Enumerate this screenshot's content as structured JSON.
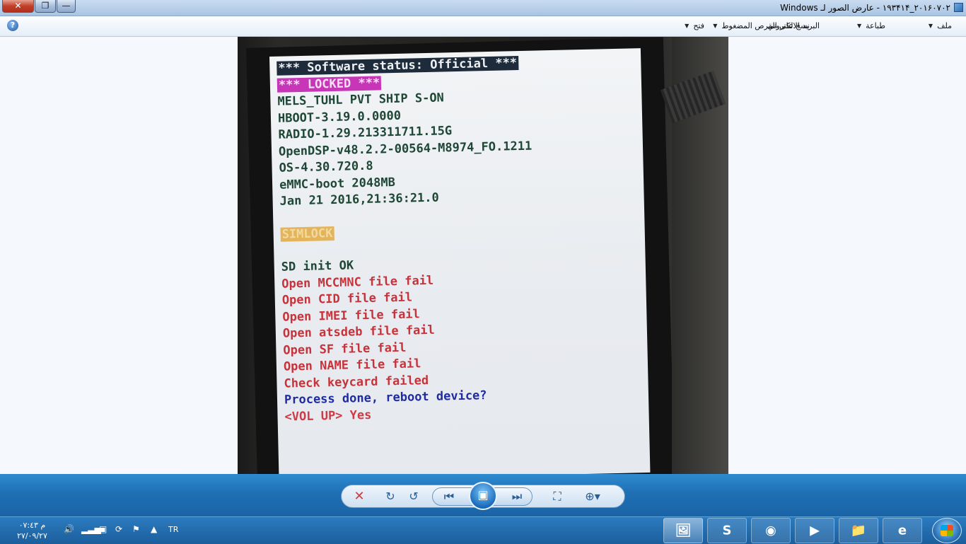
{
  "window": {
    "title": "۲۰۱۶۰۷۰۲_۱۹۳۴۱۴ - عارض الصور لـ Windows",
    "close_glyph": "✕",
    "max_glyph": "❐",
    "min_glyph": "—"
  },
  "menu": {
    "file": "ملف",
    "print": "طباعة",
    "email": "البريد الالكتروني",
    "burn": "نسخ على القرص المضغوط",
    "open": "فتح",
    "help_glyph": "?"
  },
  "screen": {
    "status_line": "*** Software status: Official ***",
    "locked_line": "*** LOCKED ***",
    "lines_green": [
      "MELS_TUHL PVT SHIP S-ON",
      "HBOOT-3.19.0.0000",
      "RADIO-1.29.213311711.15G",
      "OpenDSP-v48.2.2-00564-M8974_FO.1211",
      "OS-4.30.720.8",
      "eMMC-boot 2048MB",
      "Jan 21 2016,21:36:21.0"
    ],
    "simlock": "SIMLOCK",
    "sd_init": "SD init OK",
    "lines_red": [
      "Open MCCMNC file fail",
      "Open CID file fail",
      "Open IMEI file fail",
      "Open atsdeb file fail",
      "Open SF file fail",
      "Open NAME file fail",
      "Check keycard failed"
    ],
    "prompt": "Process done, reboot device?",
    "option": "<VOL UP> Yes"
  },
  "controls": {
    "delete_glyph": "✕",
    "rotate_cw_glyph": "↻",
    "rotate_ccw_glyph": "↺",
    "prev_glyph": "⏮",
    "next_glyph": "⏭",
    "slideshow_glyph": "▣",
    "fit_glyph": "⛶",
    "zoom_glyph": "⊕▾"
  },
  "taskbar": {
    "time": "۰۷:٤۳ م",
    "date": "۲۷/۰۹/۲۷",
    "language": "TR",
    "apps": [
      {
        "name": "photo-viewer",
        "glyph": "🖼"
      },
      {
        "name": "skype",
        "glyph": "S"
      },
      {
        "name": "chrome",
        "glyph": "◉"
      },
      {
        "name": "media-player",
        "glyph": "▶"
      },
      {
        "name": "explorer",
        "glyph": "📁"
      },
      {
        "name": "internet-explorer",
        "glyph": "e"
      }
    ]
  }
}
